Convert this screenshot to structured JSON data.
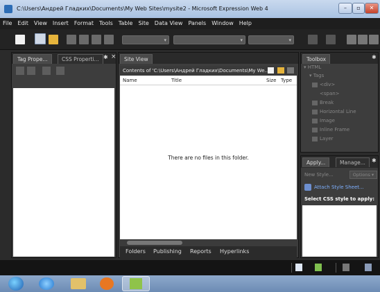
{
  "window": {
    "title": "C:\\Users\\Андрей Гладких\\Documents\\My Web Sites\\mysite2 - Microsoft Expression Web 4",
    "min": "–",
    "max": "▫",
    "close": "✕"
  },
  "menu": [
    "File",
    "Edit",
    "View",
    "Insert",
    "Format",
    "Tools",
    "Table",
    "Site",
    "Data View",
    "Panels",
    "Window",
    "Help"
  ],
  "left_panel": {
    "tab1": "Tag Prope...",
    "tab2": "CSS Properti...",
    "pin": "✱",
    "close": "×"
  },
  "site_view": {
    "tab": "Site View",
    "path": "Contents of 'C:\\Users\\Андрей Гладких\\Documents\\My We...",
    "columns": [
      "Name",
      "Title",
      "Size",
      "Type"
    ],
    "empty_message": "There are no files in this folder.",
    "bottom_tabs": [
      "Folders",
      "Publishing",
      "Reports",
      "Hyperlinks"
    ]
  },
  "toolbox": {
    "title": "Toolbox",
    "pin": "✱",
    "items": [
      "▾ HTML",
      "▾ Tags",
      "<div>",
      "<span>",
      "Break",
      "Horizontal Line",
      "Image",
      "Inline Frame",
      "Layer"
    ]
  },
  "apply_panel": {
    "tab1": "Apply...",
    "tab2": "Manage...",
    "pin": "✱",
    "new_style": "New Style...",
    "options": "Options ▾",
    "attach": "Attach Style Sheet...",
    "select_label": "Select CSS style to apply:"
  }
}
